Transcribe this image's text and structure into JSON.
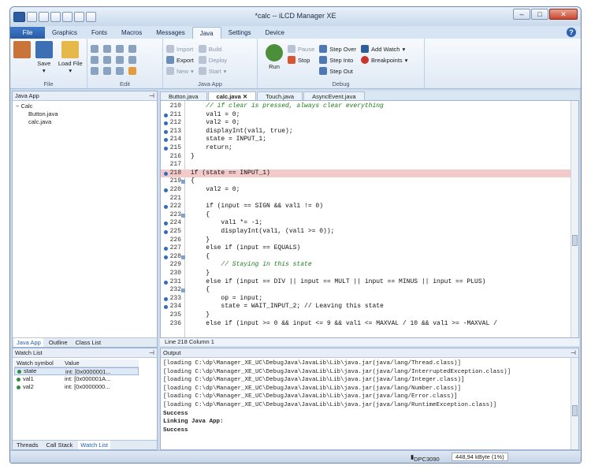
{
  "window": {
    "title": "*calc -- iLCD Manager XE",
    "min": "–",
    "max": "□",
    "close": "✕"
  },
  "menu_tabs": [
    "File",
    "Graphics",
    "Fonts",
    "Macros",
    "Messages",
    "Java",
    "Settings",
    "Device"
  ],
  "help_label": "?",
  "ribbon": {
    "file": {
      "save": "Save",
      "load": "Load File",
      "label": "File"
    },
    "edit": {
      "label": "Edit"
    },
    "javaapp": {
      "import": "Import",
      "build": "Build",
      "export": "Export",
      "deploy": "Deploy",
      "new": "New",
      "start": "Start",
      "label": "Java App"
    },
    "debug": {
      "run": "Run",
      "pause": "Pause",
      "stop": "Stop",
      "step_over": "Step Over",
      "step_into": "Step Into",
      "step_out": "Step Out",
      "add_watch": "Add Watch",
      "breakpoints": "Breakpoints",
      "label": "Debug"
    }
  },
  "java_app_pane": {
    "title": "Java App",
    "tree": [
      "Calc",
      "Button.java",
      "calc.java"
    ],
    "tabs": [
      "Java App",
      "Outline",
      "Class List"
    ]
  },
  "editor": {
    "tabs": [
      "Button.java",
      "calc.java",
      "Touch.java",
      "AsyncEvent.java"
    ],
    "close_icon": "✕",
    "lines": [
      {
        "n": "210",
        "t": "    // if clear is pressed, always clear everything",
        "c": true
      },
      {
        "n": "211",
        "t": "    val1 = 0;"
      },
      {
        "n": "212",
        "t": "    val2 = 0;"
      },
      {
        "n": "213",
        "t": "    displayInt(val1, true);"
      },
      {
        "n": "214",
        "t": "    state = INPUT_1;"
      },
      {
        "n": "215",
        "t": "    return;"
      },
      {
        "n": "216",
        "t": "}"
      },
      {
        "n": "217",
        "t": ""
      },
      {
        "n": "218",
        "t": "if (state == INPUT_1)",
        "hl": true
      },
      {
        "n": "219",
        "t": "{"
      },
      {
        "n": "220",
        "t": "    val2 = 0;"
      },
      {
        "n": "221",
        "t": ""
      },
      {
        "n": "222",
        "t": "    if (input == SIGN && val1 != 0)"
      },
      {
        "n": "223",
        "t": "    {"
      },
      {
        "n": "224",
        "t": "        val1 *= -1;"
      },
      {
        "n": "225",
        "t": "        displayInt(val1, (val1 >= 0));"
      },
      {
        "n": "226",
        "t": "    }"
      },
      {
        "n": "227",
        "t": "    else if (input == EQUALS)"
      },
      {
        "n": "228",
        "t": "    {"
      },
      {
        "n": "229",
        "t": "        // Staying in this state",
        "c": true
      },
      {
        "n": "230",
        "t": "    }"
      },
      {
        "n": "231",
        "t": "    else if (input == DIV || input == MULT || input == MINUS || input == PLUS)"
      },
      {
        "n": "232",
        "t": "    {"
      },
      {
        "n": "233",
        "t": "        op = input;"
      },
      {
        "n": "234",
        "t": "        state = WAIT_INPUT_2; // Leaving this state"
      },
      {
        "n": "235",
        "t": "    }"
      },
      {
        "n": "236",
        "t": "    else if (input >= 0 && input <= 9 && val1 <= MAXVAL / 10 && val1 >= -MAXVAL /"
      }
    ],
    "status": "Line 218 Column 1"
  },
  "watch": {
    "title": "Watch List",
    "headers": [
      "Watch symbol",
      "Value"
    ],
    "rows": [
      {
        "sym": "state",
        "val": "int: [0x0000001..."
      },
      {
        "sym": "val1",
        "val": "int: [0x000001A..."
      },
      {
        "sym": "val2",
        "val": "int: [0x0000000..."
      }
    ],
    "tabs": [
      "Threads",
      "Call Stack",
      "Watch List"
    ]
  },
  "output": {
    "title": "Output",
    "lines": [
      "[loading C:\\dp\\Manager_XE_UC\\DebugJava\\JavaLib\\Lib\\java.jar(java/lang/Thread.class)]",
      "[loading C:\\dp\\Manager_XE_UC\\DebugJava\\JavaLib\\Lib\\java.jar(java/lang/InterruptedException.class)]",
      "[loading C:\\dp\\Manager_XE_UC\\DebugJava\\JavaLib\\Lib\\java.jar(java/lang/Integer.class)]",
      "[loading C:\\dp\\Manager_XE_UC\\DebugJava\\JavaLib\\Lib\\java.jar(java/lang/Number.class)]",
      "[loading C:\\dp\\Manager_XE_UC\\DebugJava\\JavaLib\\Lib\\java.jar(java/lang/Error.class)]",
      "[loading C:\\dp\\Manager_XE_UC\\DebugJava\\JavaLib\\Lib\\java.jar(java/lang/RuntimeException.class)]",
      "Success",
      "Linking Java App:",
      "Success"
    ]
  },
  "statusbar": {
    "device": "DPC3090",
    "memory": "448,94 kByte (1%)"
  }
}
